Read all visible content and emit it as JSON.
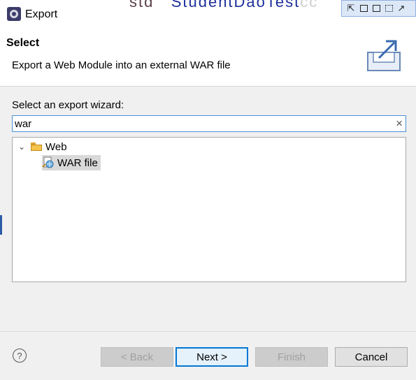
{
  "window": {
    "title": "Export",
    "background_fragment_1": "std",
    "background_fragment_2": "StudentDaoTest",
    "background_fragment_3": "cc"
  },
  "header": {
    "title": "Select",
    "description": "Export a Web Module into an external WAR file"
  },
  "wizard": {
    "label": "Select an export wizard:",
    "filter_value": "war",
    "tree": [
      {
        "label": "Web",
        "expanded": true,
        "children": [
          {
            "label": "WAR file",
            "selected": true
          }
        ]
      }
    ]
  },
  "buttons": {
    "back": "< Back",
    "next": "Next >",
    "finish": "Finish",
    "cancel": "Cancel"
  },
  "colors": {
    "accent": "#0078d7",
    "selection": "#d9d9d9",
    "folder": "#f5c44a"
  },
  "icons": [
    "eclipse-app-icon",
    "export-banner-icon",
    "clear-icon",
    "chevron-down-icon",
    "folder-open-icon",
    "war-file-icon",
    "help-icon"
  ]
}
